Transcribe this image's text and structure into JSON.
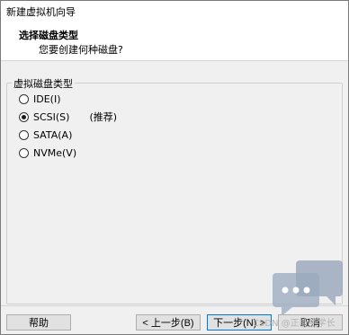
{
  "window": {
    "title": "新建虚拟机向导"
  },
  "header": {
    "title": "选择磁盘类型",
    "subtitle": "您要创建何种磁盘?"
  },
  "disk_type_group": {
    "legend": "虚拟磁盘类型",
    "options": [
      {
        "label": "IDE(I)",
        "checked": false
      },
      {
        "label": "SCSI(S)",
        "checked": true,
        "note": "(推荐)"
      },
      {
        "label": "SATA(A)",
        "checked": false
      },
      {
        "label": "NVMe(V)",
        "checked": false
      }
    ]
  },
  "footer": {
    "help_label": "帮助",
    "back_label": "< 上一步(B)",
    "next_label": "下一步(N) >",
    "cancel_label": "取消"
  },
  "watermark": {
    "text": "CSDN @正能量学长",
    "icon": "chat-bubbles-icon",
    "color": "#8a9bb0"
  }
}
